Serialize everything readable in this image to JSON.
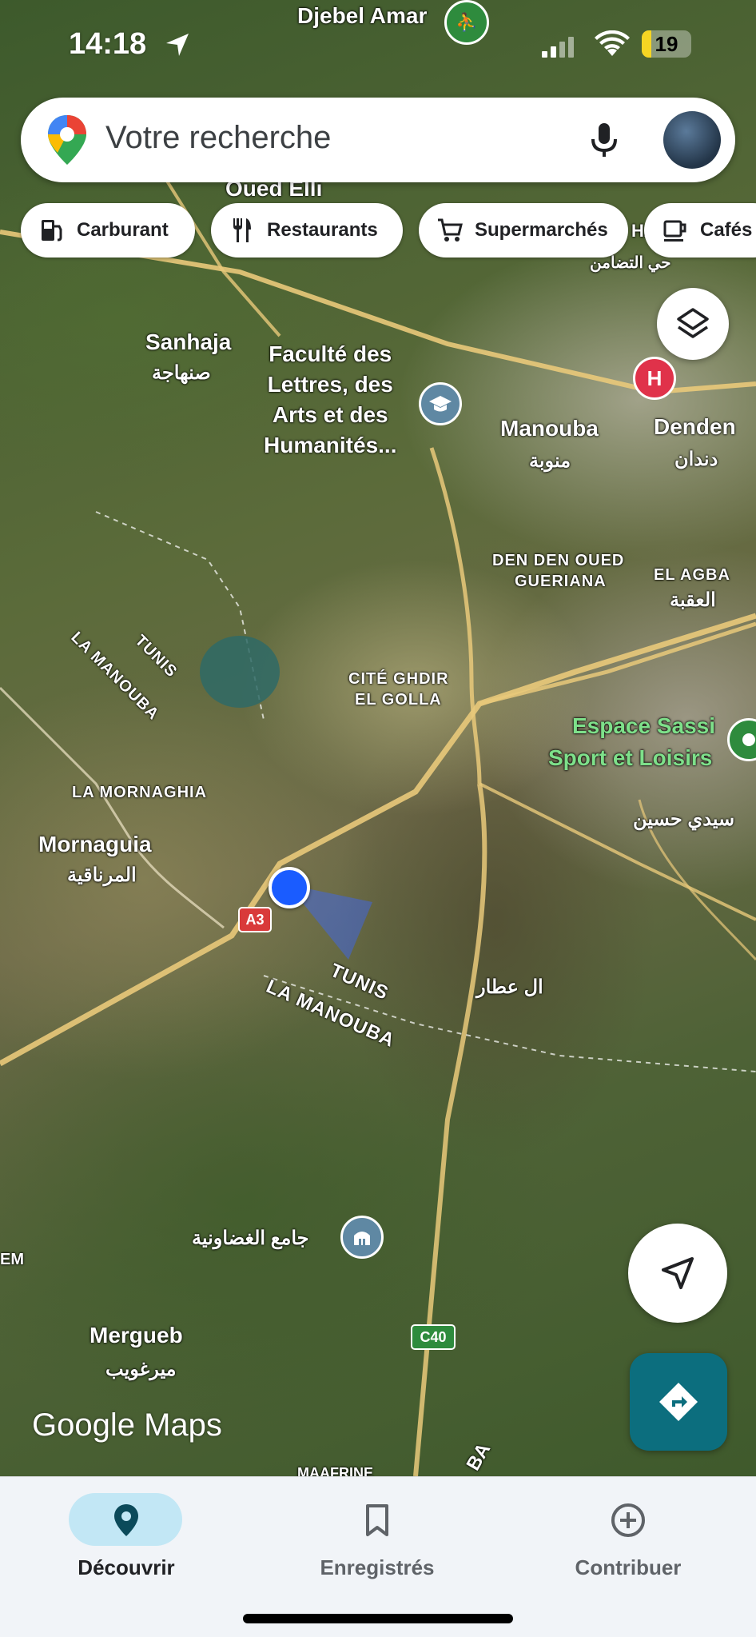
{
  "status_bar": {
    "time": "14:18",
    "battery_level": "19"
  },
  "search": {
    "placeholder": "Votre recherche"
  },
  "chips": [
    {
      "label": "Carburant",
      "icon": "fuel-icon"
    },
    {
      "label": "Restaurants",
      "icon": "restaurant-icon"
    },
    {
      "label": "Supermarchés",
      "icon": "cart-icon"
    },
    {
      "label": "Cafés",
      "icon": "cafe-icon"
    }
  ],
  "map": {
    "labels": {
      "djebel_amar": "Djebel Amar",
      "oued_elli": "Oued Elli",
      "sanhaja": "Sanhaja",
      "sanhaja_ar": "صنهاجة",
      "faculte": "Faculté des\nLettres, des\nArts et des\nHumanités...",
      "manouba": "Manouba",
      "manouba_ar": "منوبة",
      "denden": "Denden",
      "denden_ar": "دندان",
      "den_den_oued": "DEN DEN OUED",
      "gueriana": "GUERIANA",
      "el_agba": "EL AGBA",
      "el_agba_ar": "العقبة",
      "tunis_1": "TUNIS",
      "la_manouba_1": "LA MANOUBA",
      "cite_ghdir": "CITÉ GHDIR",
      "el_golla": "EL GOLLA",
      "espace_sassi_1": "Espace Sassi",
      "espace_sassi_2": "Sport et Loisirs",
      "sidi_hassine_ar": "سيدي حسين",
      "la_mornaghia": "LA MORNAGHIA",
      "mornaguia": "Mornaguia",
      "mornaguia_ar": "المرناقية",
      "a3": "A3",
      "tunis_2": "TUNIS",
      "la_manouba_2": "LA MANOUBA",
      "al_atar_ar": "ال عطار",
      "mosque_ar": "جامع الغضاونية",
      "em": "EM",
      "mergueb": "Mergueb",
      "mergueb_ar": "ميرغويب",
      "c40": "C40",
      "maafrine": "MAAFRINE",
      "ba": "BA",
      "ha": "HA",
      "ar_top_right": "حي التضامن"
    },
    "hospital_letter": "H",
    "logo": "Google Maps"
  },
  "nav": [
    {
      "label": "Découvrir",
      "icon": "pin-icon",
      "active": true
    },
    {
      "label": "Enregistrés",
      "icon": "bookmark-icon",
      "active": false
    },
    {
      "label": "Contribuer",
      "icon": "plus-circle-icon",
      "active": false
    }
  ],
  "colors": {
    "nav_active_pill": "#c2e7f5",
    "directions_button": "#0c6e7e",
    "location_dot": "#1a5cff"
  }
}
